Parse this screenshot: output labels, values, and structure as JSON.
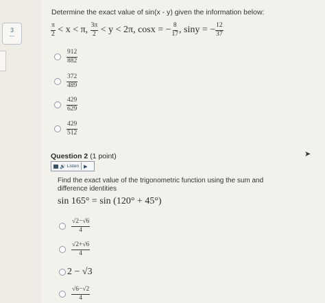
{
  "pager": {
    "current": "3",
    "dash": "---"
  },
  "q1": {
    "stem": "Determine the exact value of sin(x - y) given the information below:",
    "cond": {
      "f1_num": "π",
      "f1_den": "2",
      "part1": " < x < π, ",
      "f2_num": "3π",
      "f2_den": "2",
      "part2": " < y < 2π, cosx = −",
      "f3_num": "8",
      "f3_den": "17",
      "part3": ", siny = −",
      "f4_num": "12",
      "f4_den": "37"
    },
    "choices": [
      {
        "num": "912",
        "den": "882"
      },
      {
        "num": "372",
        "den": "489"
      },
      {
        "num": "429",
        "den": "629"
      },
      {
        "num": "429",
        "den": "512"
      }
    ]
  },
  "q2": {
    "title": "Question 2",
    "points": "(1 point)",
    "listen": "Listen",
    "text": "Find the exact value of the trigonometric function using the sum and difference identities",
    "equation": "sin 165° = sin (120° + 45°)",
    "choices": [
      {
        "num": "√2−√6",
        "den": "4"
      },
      {
        "num": "√2+√6",
        "den": "4"
      },
      {
        "text": "2 − √3"
      },
      {
        "num": "√6−√2",
        "den": "4"
      }
    ]
  },
  "icons": [
    "speaker-icon",
    "play-icon",
    "toolbar-icon",
    "cursor-icon"
  ],
  "colors": {
    "background": "#f3f1ec",
    "radio_border": "#8e98a6",
    "link": "#4b6b86"
  }
}
